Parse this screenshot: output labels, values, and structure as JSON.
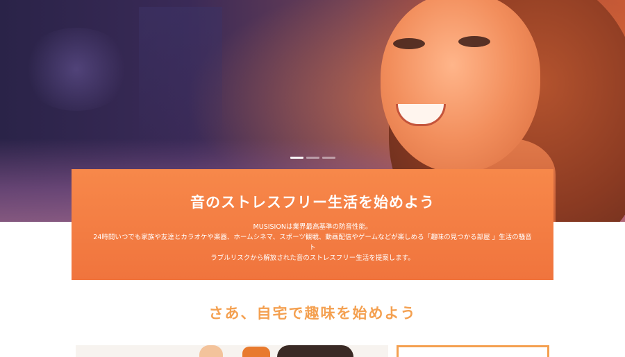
{
  "hero": {
    "slider": {
      "count": 3,
      "active_index": 0
    }
  },
  "intro": {
    "title": "音のストレスフリー生活を始めよう",
    "line1": "MUSISIONは業界最高基準の防音性能。",
    "line2": "24時間いつでも家族や友達とカラオケや楽器、ホームシネマ、スポーツ観戦、動画配信やゲームなどが楽しめる「趣味の見つかる部屋 」生活の騒音ト",
    "line3": "ラブルリスクから解放された音のストレスフリー生活を提案します。",
    "background_color": "#f27a40"
  },
  "section": {
    "heading": "さあ、自宅で趣味を始めよう",
    "accent_color": "#f4a050"
  }
}
